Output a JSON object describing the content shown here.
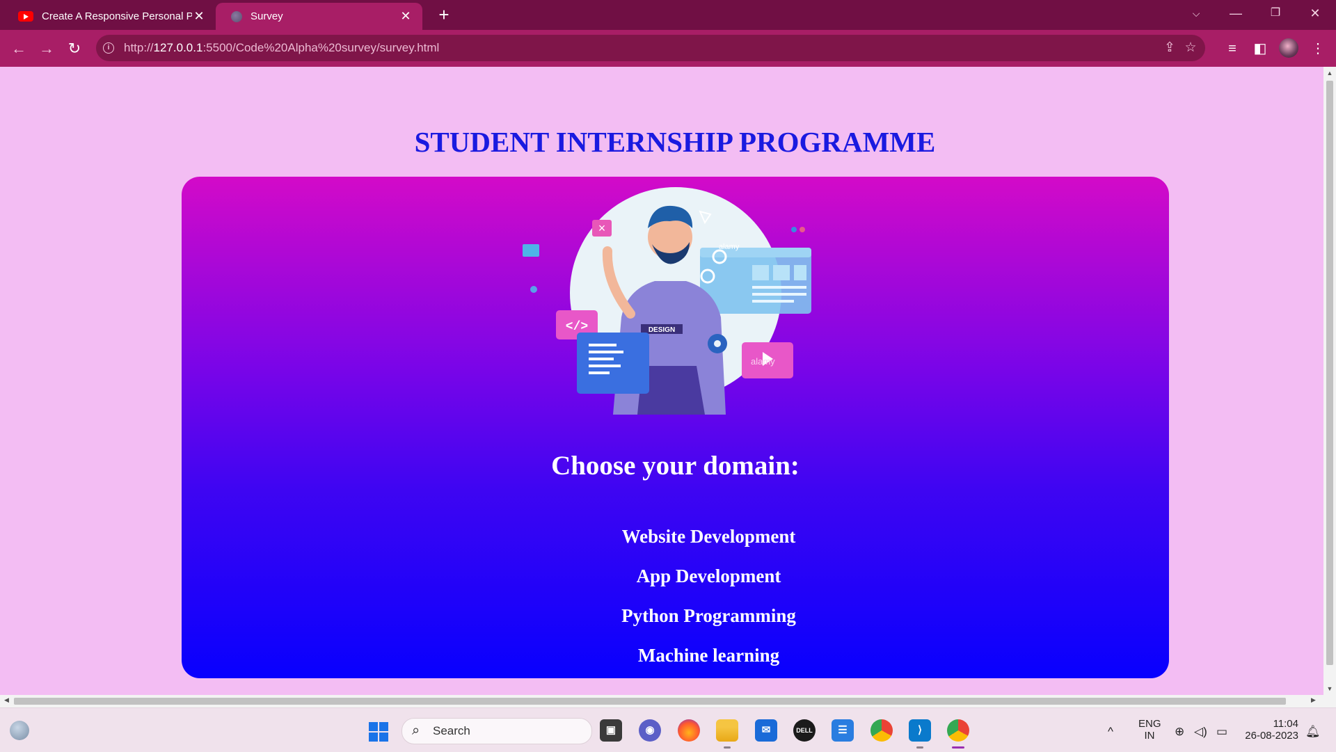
{
  "browser": {
    "tabs": [
      {
        "title": "Create A Responsive Personal PC",
        "icon": "youtube-icon",
        "active": false
      },
      {
        "title": "Survey",
        "icon": "globe-icon",
        "active": true
      }
    ],
    "url_scheme": "http://",
    "url_host": "127.0.0.1",
    "url_rest": ":5500/Code%20Alpha%20survey/survey.html"
  },
  "page": {
    "title": "STUDENT INTERNSHIP PROGRAMME",
    "illustration_labels": {
      "shirt": "DESIGN",
      "badge": "alamy",
      "media": "alamy"
    },
    "domain_heading": "Choose your domain:",
    "domains": [
      "Website Development",
      "App Development",
      "Python Programming",
      "Machine learning"
    ],
    "colors": {
      "background": "#f3bdf3",
      "title": "#1a1ae0",
      "card_top": "#d30ac8",
      "card_bottom": "#0800fe"
    }
  },
  "taskbar": {
    "search_placeholder": "Search",
    "apps": [
      "file-explorer-icon",
      "chat-icon",
      "firefox-icon",
      "folder-icon",
      "mail-icon",
      "dell-icon",
      "notepad-icon",
      "chrome-icon",
      "vscode-icon",
      "chrome-canary-icon"
    ],
    "dell_label": "DELL",
    "lang_line1": "ENG",
    "lang_line2": "IN",
    "time": "11:04",
    "date": "26-08-2023"
  }
}
